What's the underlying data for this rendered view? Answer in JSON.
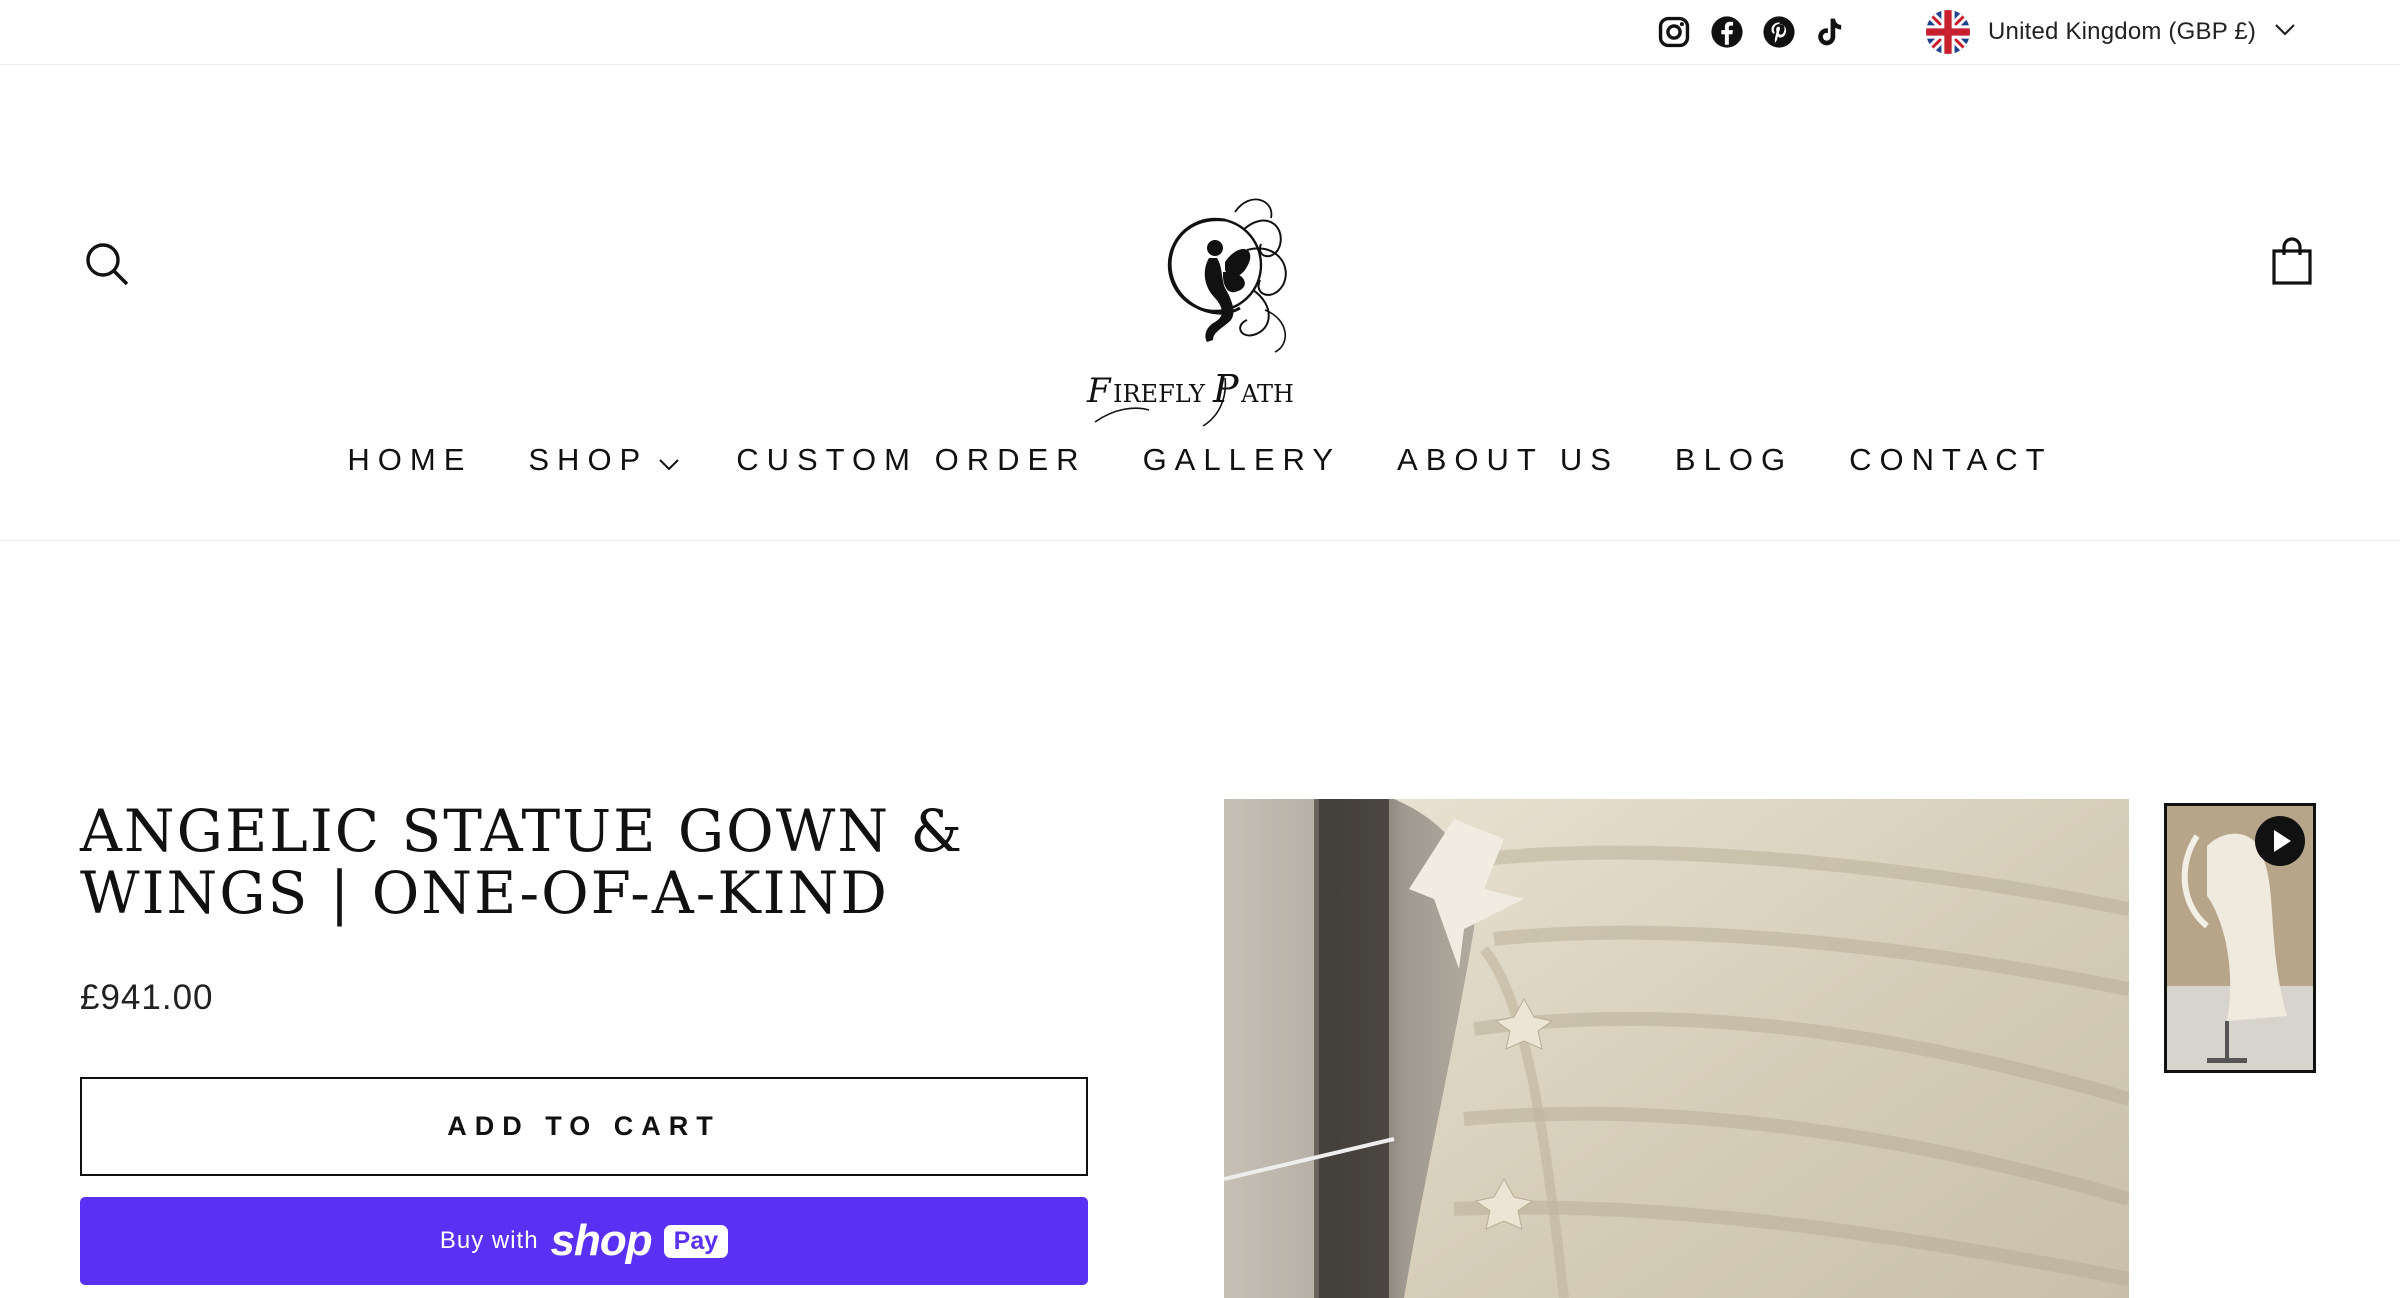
{
  "topbar": {
    "social_icons": [
      "instagram-icon",
      "facebook-icon",
      "pinterest-icon",
      "tiktok-icon"
    ],
    "locale": {
      "flag_icon": "uk-flag-icon",
      "label": "United Kingdom (GBP £)",
      "chevron_icon": "chevron-down-icon"
    }
  },
  "header": {
    "search_icon": "search-icon",
    "cart_icon": "cart-bag-icon",
    "logo_text": "Firefly Path"
  },
  "nav": {
    "items": [
      {
        "label": "HOME"
      },
      {
        "label": "SHOP",
        "has_dropdown": true
      },
      {
        "label": "CUSTOM ORDER"
      },
      {
        "label": "GALLERY"
      },
      {
        "label": "ABOUT US"
      },
      {
        "label": "BLOG"
      },
      {
        "label": "CONTACT"
      }
    ]
  },
  "product": {
    "title": "ANGELIC STATUE GOWN & WINGS | ONE-OF-A-KIND",
    "price": "£941.00",
    "add_to_cart_label": "ADD TO CART",
    "shoppay": {
      "buy_with": "Buy with",
      "shop": "shop",
      "pay": "Pay"
    },
    "main_image_alt": "ivory gown fabric close-up",
    "thumbnail_icon": "play-icon"
  },
  "colors": {
    "accent": "#5a31f4",
    "text": "#111111",
    "divider": "#ececec"
  }
}
